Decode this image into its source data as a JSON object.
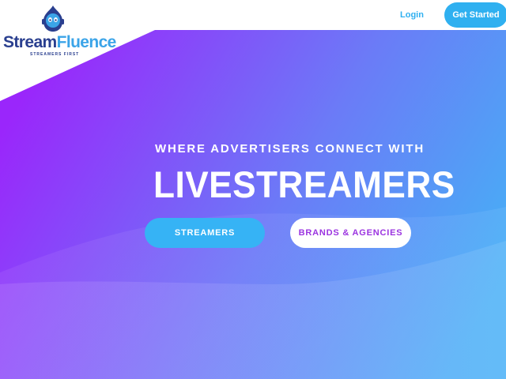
{
  "header": {
    "logo": {
      "word_part1": "Stream",
      "word_part2": "Fluence",
      "tagline": "STREAMERS FIRST",
      "icon": "robot-mascot-icon"
    },
    "nav": {
      "login_label": "Login",
      "cta_label": "Get Started"
    }
  },
  "hero": {
    "subtitle": "WHERE ADVERTISERS CONNECT WITH",
    "title": "LIVESTREAMERS",
    "buttons": {
      "streamers_label": "STREAMERS",
      "brands_label": "BRANDS & AGENCIES"
    }
  },
  "colors": {
    "gradient_start": "#9a26fb",
    "gradient_end": "#46b0f6",
    "accent_blue": "#2fb0f0",
    "brand_navy": "#2a3f8f",
    "brands_text": "#9b34e0"
  }
}
